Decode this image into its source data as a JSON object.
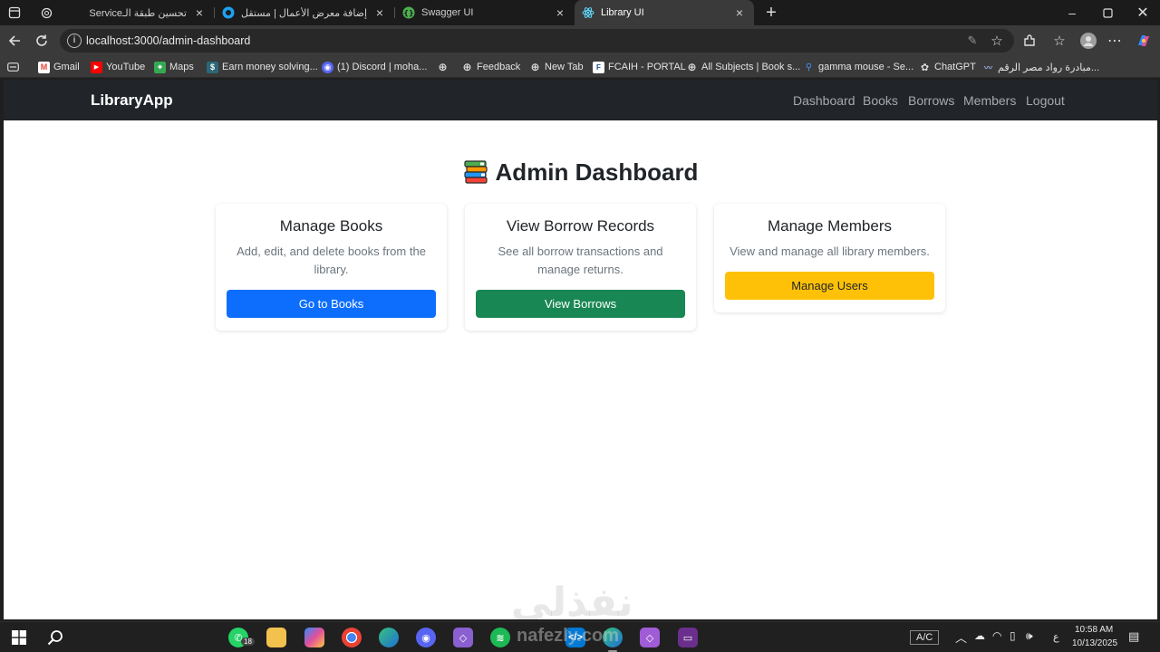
{
  "browser": {
    "tabs": [
      {
        "title": "Serviceتحسين طبقة الـ"
      },
      {
        "title": "إضافة معرض الأعمال | مستقل"
      },
      {
        "title": "Swagger UI"
      },
      {
        "title": "Library UI"
      }
    ],
    "url": "localhost:3000/admin-dashboard",
    "bookmarks": [
      "Gmail",
      "YouTube",
      "Maps",
      "Earn money solving...",
      "(1) Discord | moha...",
      "Feedback",
      "New Tab",
      "FCAIH - PORTAL",
      "All Subjects | Book s...",
      "gamma mouse - Se...",
      "ChatGPT",
      "مبادرة رواد مصر الرقم..."
    ]
  },
  "app": {
    "brand": "LibraryApp",
    "nav": [
      "Dashboard",
      "Books",
      "Borrows",
      "Members",
      "Logout"
    ],
    "title": "Admin Dashboard",
    "cards": [
      {
        "title": "Manage Books",
        "desc": "Add, edit, and delete books from the library.",
        "button": "Go to Books",
        "color": "#0d6efd"
      },
      {
        "title": "View Borrow Records",
        "desc": "See all borrow transactions and manage returns.",
        "button": "View Borrows",
        "color": "#198754"
      },
      {
        "title": "Manage Members",
        "desc": "View and manage all library members.",
        "button": "Manage Users",
        "color": "#ffc107"
      }
    ]
  },
  "taskbar": {
    "whatsapp_badge": "18",
    "keyboard": "A/C",
    "lang": "ع",
    "time": "10:58 AM",
    "date": "10/13/2025"
  },
  "watermark": {
    "arabic": "نفذلي",
    "latin": "nafezly.com"
  }
}
